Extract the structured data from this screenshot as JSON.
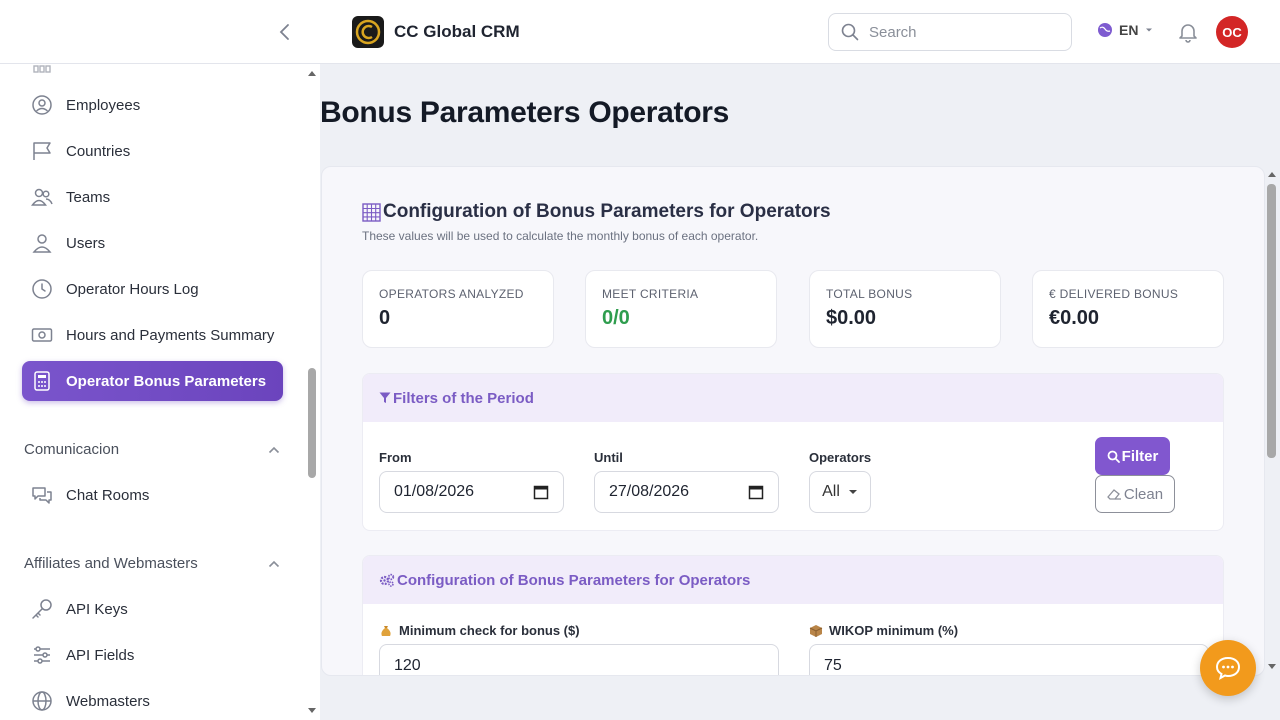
{
  "header": {
    "brand": "CC Global CRM",
    "search_placeholder": "Search",
    "language": "EN",
    "avatar_initials": "OC"
  },
  "sidebar": {
    "items": [
      {
        "label": "Employees",
        "icon": "user-circle-icon"
      },
      {
        "label": "Countries",
        "icon": "flag-icon"
      },
      {
        "label": "Teams",
        "icon": "users-icon"
      },
      {
        "label": "Users",
        "icon": "user-icon"
      },
      {
        "label": "Operator Hours Log",
        "icon": "clock-icon"
      },
      {
        "label": "Hours and Payments Summary",
        "icon": "money-icon"
      },
      {
        "label": "Operator Bonus Parameters",
        "icon": "calculator-icon",
        "active": true
      }
    ],
    "sections": [
      {
        "title": "Comunicacion",
        "items": [
          {
            "label": "Chat Rooms",
            "icon": "chat-icon"
          }
        ]
      },
      {
        "title": "Affiliates and Webmasters",
        "items": [
          {
            "label": "API Keys",
            "icon": "key-icon"
          },
          {
            "label": "API Fields",
            "icon": "sliders-icon"
          },
          {
            "label": "Webmasters",
            "icon": "globe-icon"
          }
        ]
      }
    ]
  },
  "page": {
    "title": "Bonus Parameters Operators",
    "card_title": "Configuration of Bonus Parameters for Operators",
    "card_subtitle": "These values will be used to calculate the monthly bonus of each operator."
  },
  "stats": [
    {
      "label": "OPERATORS ANALYZED",
      "value": "0"
    },
    {
      "label": "MEET CRITERIA",
      "value": "0/0"
    },
    {
      "label": "TOTAL BONUS",
      "value": "$0.00"
    },
    {
      "label": "€ DELIVERED BONUS",
      "value": "€0.00"
    }
  ],
  "filters": {
    "title": "Filters of the Period",
    "from_label": "From",
    "from_value": "01/08/2026",
    "until_label": "Until",
    "until_value": "27/08/2026",
    "operators_label": "Operators",
    "operators_value": "All",
    "filter_button": "Filter",
    "clean_button": "Clean"
  },
  "config": {
    "title": "Configuration of Bonus Parameters for Operators",
    "min_check_label": "Minimum check for bonus ($)",
    "min_check_value": "120",
    "wikop_label": "WIKOP minimum (%)",
    "wikop_value": "75"
  },
  "colors": {
    "accent": "#7b5cc4",
    "active_nav": "#6b44bd",
    "success": "#2e9d4e",
    "avatar": "#d32626",
    "chat_fab": "#f29a1c"
  }
}
